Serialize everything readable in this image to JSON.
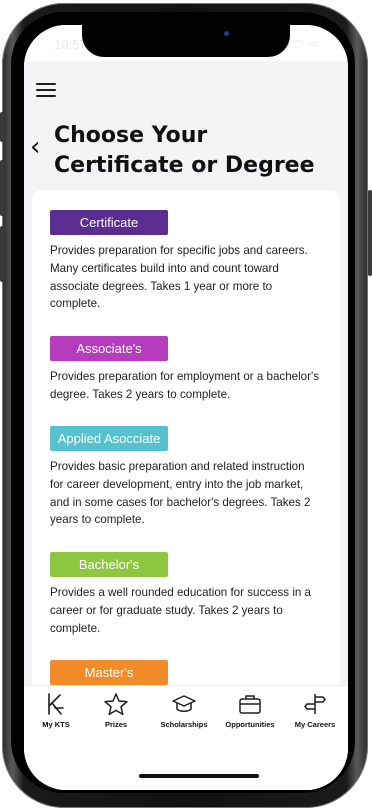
{
  "status_bar": {
    "time": "10:57",
    "icons": "●● ◠ ▭"
  },
  "header": {
    "title": "Choose Your Certificate or Degree"
  },
  "programs": [
    {
      "label": "Certificate",
      "color": "#5b2d91",
      "description": "Provides preparation for specific jobs and careers. Many certificates build into and count toward associate degrees. Takes 1 year or more to complete."
    },
    {
      "label": "Associate's",
      "color": "#b53dbd",
      "description": "Provides preparation for employment or a bachelor's degree. Takes 2 years to complete."
    },
    {
      "label": "Applied Asocciate",
      "color": "#55c2cf",
      "description": "Provides basic preparation and related instruction for career development, entry into the job market, and in some cases for bachelor's degrees. Takes 2 years to complete."
    },
    {
      "label": "Bachelor's",
      "color": "#8dc63f",
      "description": "Provides a well rounded education for success in a career or for graduate study. Takes 2 years to complete."
    },
    {
      "label": "Master's",
      "color": "#f28c28",
      "description": ""
    }
  ],
  "tabbar": {
    "items": [
      {
        "label": "My KTS",
        "icon": "kts-logo-icon"
      },
      {
        "label": "Prizes",
        "icon": "star-icon"
      },
      {
        "label": "Scholarships",
        "icon": "graduation-cap-icon"
      },
      {
        "label": "Opportunities",
        "icon": "briefcase-icon"
      },
      {
        "label": "My Careers",
        "icon": "signpost-icon"
      }
    ]
  }
}
